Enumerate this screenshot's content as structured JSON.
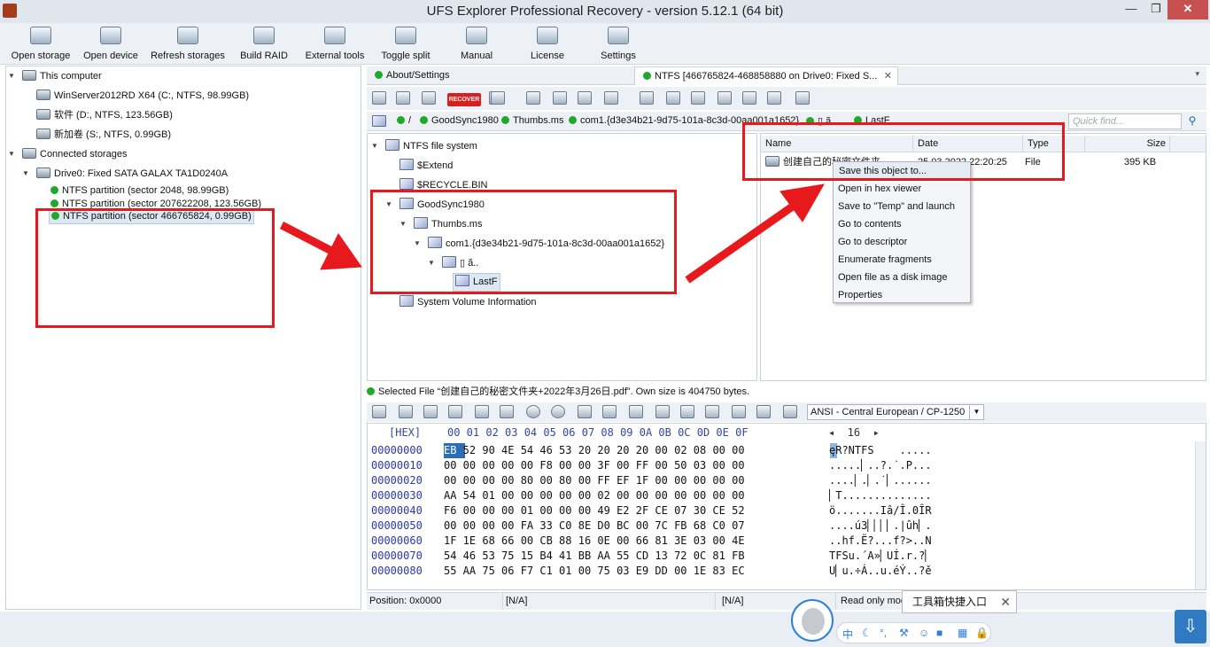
{
  "window": {
    "title": "UFS Explorer Professional Recovery - version 5.12.1 (64 bit)",
    "min": "—",
    "max": "❐",
    "close": "✕"
  },
  "toolbar": {
    "open_storage": "Open storage",
    "open_device": "Open device",
    "refresh": "Refresh storages",
    "build_raid": "Build RAID",
    "external_tools": "External tools",
    "toggle_split": "Toggle split",
    "manual": "Manual",
    "license": "License",
    "settings": "Settings"
  },
  "storage_tree": {
    "this_computer": "This computer",
    "items": [
      "WinServer2012RD X64 (C:, NTFS, 98.99GB)",
      "软件 (D:, NTFS, 123.56GB)",
      "新加卷 (S:, NTFS, 0.99GB)"
    ],
    "connected_storages": "Connected storages",
    "drive": "Drive0: Fixed SATA GALAX TA1D0240A",
    "partitions": [
      "NTFS partition (sector 2048, 98.99GB)",
      "NTFS partition (sector 207622208, 123.56GB)",
      "NTFS partition (sector 466765824, 0.99GB)"
    ]
  },
  "tabs": {
    "about": "About/Settings",
    "ntfs": "NTFS [466765824-468858880 on Drive0: Fixed S...",
    "close": "✕",
    "chevron": "▾"
  },
  "action_bar": {
    "recover": "RECOVER"
  },
  "path": {
    "root": "/",
    "parts": [
      "GoodSync1980",
      "Thumbs.ms",
      "com1.{d3e34b21-9d75-101a-8c3d-00aa001a1652}",
      "▯ ã..",
      "LastF"
    ],
    "quick_find": "Quick find..."
  },
  "folder_tree": {
    "root": "NTFS file system",
    "extend": "$Extend",
    "recycle": "$RECYCLE.BIN",
    "goodsync": "GoodSync1980",
    "thumbs": "Thumbs.ms",
    "com1": "com1.{d3e34b21-9d75-101a-8c3d-00aa001a1652}",
    "odd": "▯  ã..",
    "lastf": "LastF",
    "sysvol": "System Volume Information"
  },
  "file_list": {
    "headers": {
      "name": "Name",
      "date": "Date",
      "type": "Type",
      "size": "Size"
    },
    "row": {
      "name": "创建自己的秘密文件夹",
      "date": "25.03.2022 22:20:25",
      "type": "File",
      "size": "395 KB"
    }
  },
  "context_menu": [
    "Save this object to...",
    "Open in hex viewer",
    "Save to \"Temp\" and launch",
    "Go to contents",
    "Go to descriptor",
    "Enumerate fragments",
    "Open file as a disk image",
    "Properties"
  ],
  "selected_status": "Selected File “创建自己的秘密文件夹+2022年3月26日.pdf”. Own size is 404750 bytes.",
  "hex": {
    "codepage": "ANSI - Central European / CP-1250",
    "header_label": "[HEX]",
    "columns": "00 01 02 03 04 05 06 07 08 09 0A 0B 0C 0D 0E 0F",
    "width_nav": "◂  16  ▸",
    "rows": [
      {
        "off": "00000000",
        "bytes": "EB 52 90 4E 54 46 53 20 20 20 20 00 02 08 00 00",
        "text": "ęR?NTFS    ....."
      },
      {
        "off": "00000010",
        "bytes": "00 00 00 00 00 F8 00 00 3F 00 FF 00 50 03 00 00",
        "text": ".....▏..?.˙.P..."
      },
      {
        "off": "00000020",
        "bytes": "00 00 00 00 80 00 80 00 FF EF 1F 00 00 00 00 00",
        "text": "....▏.▏.˙▏......"
      },
      {
        "off": "00000030",
        "bytes": "AA 54 01 00 00 00 00 00 02 00 00 00 00 00 00 00",
        "text": "▏T.............."
      },
      {
        "off": "00000040",
        "bytes": "F6 00 00 00 01 00 00 00 49 E2 2F CE 07 30 CE 52",
        "text": "ö.......Iâ/Î.0ÎR"
      },
      {
        "off": "00000050",
        "bytes": "00 00 00 00 FA 33 C0 8E D0 BC 00 7C FB 68 C0 07",
        "text": "....ú3▏▏▏▏.|ûh▏."
      },
      {
        "off": "00000060",
        "bytes": "1F 1E 68 66 00 CB 88 16 0E 00 66 81 3E 03 00 4E",
        "text": "..hf.Ë?...f?>..N"
      },
      {
        "off": "00000070",
        "bytes": "54 46 53 75 15 B4 41 BB AA 55 CD 13 72 0C 81 FB",
        "text": "TFSu.´A»▏UÍ.r.?▏"
      },
      {
        "off": "00000080",
        "bytes": "55 AA 75 06 F7 C1 01 00 75 03 E9 DD 00 1E 83 EC",
        "text": "U▏u.÷Á..u.éÝ..?ě"
      }
    ]
  },
  "status_bar": {
    "position": "Position: 0x0000",
    "na1": "[N/A]",
    "na2": "[N/A]",
    "mode": "Read only mod"
  },
  "tray": {
    "tooltip": "工具箱快捷入口",
    "ime": "中"
  },
  "annotation_color": "#e8191c"
}
